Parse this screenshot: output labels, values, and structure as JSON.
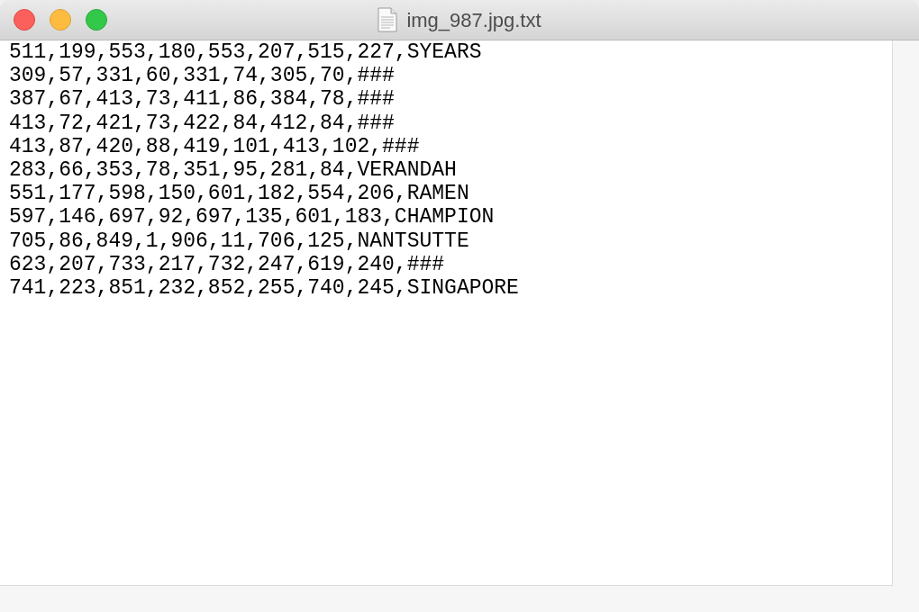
{
  "window": {
    "title": "img_987.jpg.txt"
  },
  "lines": [
    "511,199,553,180,553,207,515,227,SYEARS",
    "309,57,331,60,331,74,305,70,###",
    "387,67,413,73,411,86,384,78,###",
    "413,72,421,73,422,84,412,84,###",
    "413,87,420,88,419,101,413,102,###",
    "283,66,353,78,351,95,281,84,VERANDAH",
    "551,177,598,150,601,182,554,206,RAMEN",
    "597,146,697,92,697,135,601,183,CHAMPION",
    "705,86,849,1,906,11,706,125,NANTSUTTE",
    "623,207,733,217,732,247,619,240,###",
    "741,223,851,232,852,255,740,245,SINGAPORE"
  ]
}
